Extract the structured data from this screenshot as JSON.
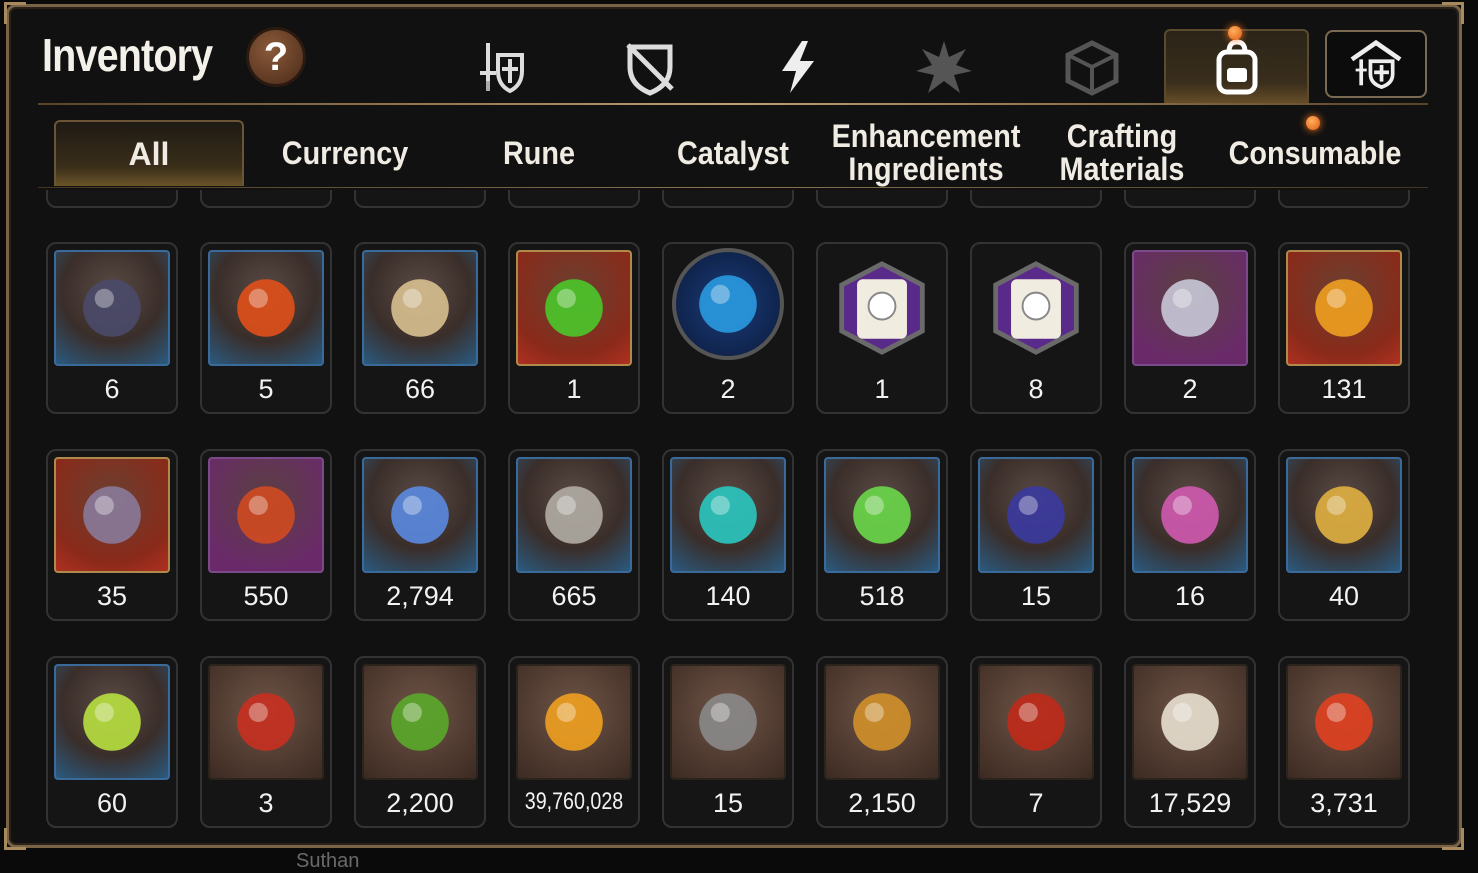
{
  "header": {
    "title": "Inventory",
    "help_label": "?"
  },
  "category_tabs": [
    {
      "icon": "sword-shield-icon",
      "active": false
    },
    {
      "icon": "broken-shield-icon",
      "active": false
    },
    {
      "icon": "lightning-bolt-icon",
      "active": false
    },
    {
      "icon": "burst-icon",
      "active": false
    },
    {
      "icon": "cube-icon",
      "active": false
    },
    {
      "icon": "backpack-icon",
      "active": true,
      "notification": true
    },
    {
      "icon": "armory-icon",
      "active": false
    }
  ],
  "sub_tabs": [
    {
      "label": "All",
      "active": true
    },
    {
      "label": "Currency"
    },
    {
      "label": "Rune"
    },
    {
      "label": "Catalyst"
    },
    {
      "label": "Enhancement Ingredients"
    },
    {
      "label": "Crafting Materials"
    },
    {
      "label": "Consumable",
      "notification": true
    }
  ],
  "items": [
    {
      "name": "iron-ore-pile-icon",
      "count": "6",
      "frame": "blue"
    },
    {
      "name": "fire-orb-icon",
      "count": "5",
      "frame": "blue"
    },
    {
      "name": "ginseng-root-icon",
      "count": "66",
      "frame": "blue"
    },
    {
      "name": "green-gem-icon",
      "count": "1",
      "frame": "red"
    },
    {
      "name": "blue-rune-disk-icon",
      "count": "2",
      "frame": "circle"
    },
    {
      "name": "pet-food-bag-icon",
      "count": "1",
      "frame": "hex"
    },
    {
      "name": "pet-treat-bag-icon",
      "count": "8",
      "frame": "hex"
    },
    {
      "name": "feather-wand-icon",
      "count": "2",
      "frame": "purple"
    },
    {
      "name": "amber-crystal-icon",
      "count": "131",
      "frame": "red"
    },
    {
      "name": "stone-ring-icon",
      "count": "35",
      "frame": "red"
    },
    {
      "name": "ruby-ring-icon",
      "count": "550",
      "frame": "purple"
    },
    {
      "name": "blue-crystal-icon",
      "count": "2,794",
      "frame": "blue"
    },
    {
      "name": "silver-coin-icon",
      "count": "665",
      "frame": "blue"
    },
    {
      "name": "teal-crystal-icon",
      "count": "140",
      "frame": "blue"
    },
    {
      "name": "green-leaf-icon",
      "count": "518",
      "frame": "blue"
    },
    {
      "name": "paw-certificate-icon",
      "count": "15",
      "frame": "blue"
    },
    {
      "name": "pink-crystal-pile-icon",
      "count": "16",
      "frame": "blue"
    },
    {
      "name": "star-ring-icon",
      "count": "40",
      "frame": "blue"
    },
    {
      "name": "costume-card-icon",
      "count": "60",
      "frame": "blue"
    },
    {
      "name": "sword-badge-icon",
      "count": "3",
      "frame": "brown"
    },
    {
      "name": "green-heart-icon",
      "count": "2,200",
      "frame": "brown"
    },
    {
      "name": "gold-coin-icon",
      "count": "39,760,028",
      "frame": "brown"
    },
    {
      "name": "stone-compass-icon",
      "count": "15",
      "frame": "brown"
    },
    {
      "name": "fist-emblem-icon",
      "count": "2,150",
      "frame": "brown"
    },
    {
      "name": "war-banner-icon",
      "count": "7",
      "frame": "brown"
    },
    {
      "name": "chess-knight-icon",
      "count": "17,529",
      "frame": "brown"
    },
    {
      "name": "red-leaf-icon",
      "count": "3,731",
      "frame": "brown"
    }
  ],
  "colors": {
    "accent_gold": "#c0a070",
    "notification": "#ff7a20",
    "background": "#111111"
  },
  "footer": {
    "partial_text": "Suthan"
  }
}
